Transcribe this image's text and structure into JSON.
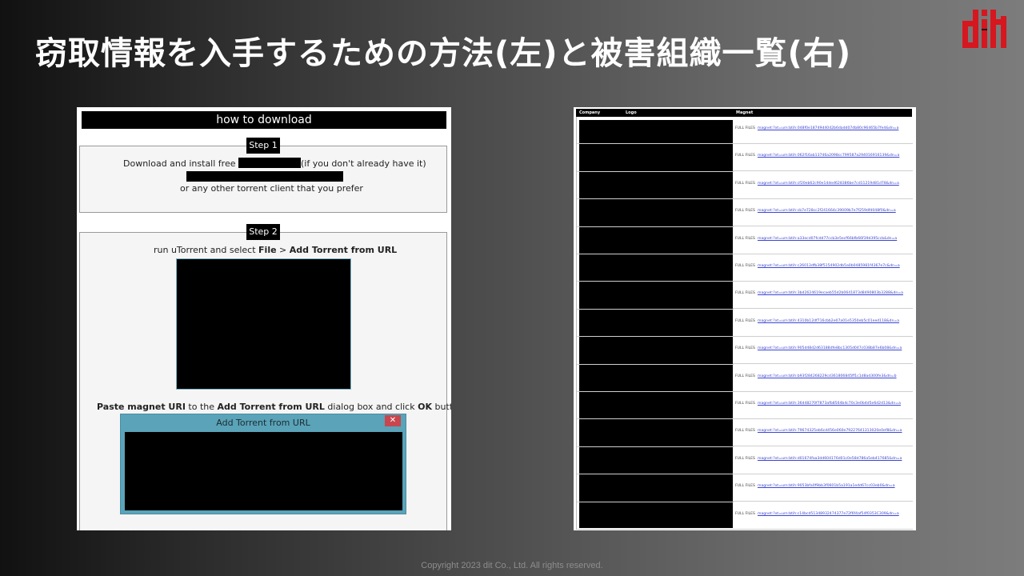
{
  "slide": {
    "title": "窃取情報を入手するための方法(左)と被害組織一覧(右)",
    "logo_text": "dit",
    "footer": "Copyright 2023 dit Co., Ltd. All rights reserved."
  },
  "left_panel": {
    "heading": "how to download",
    "step1": {
      "label": "Step 1",
      "line1_prefix": "Download and install free",
      "line1_suffix": "(if you don't already have it)",
      "line3": "or any other torrent client that you prefer"
    },
    "step2": {
      "label": "Step 2",
      "instr_prefix": "run uTorrent and select ",
      "instr_file": "File",
      "instr_sep": " > ",
      "instr_menu": "Add Torrent from URL",
      "paste_part1": "Paste magnet URI",
      "paste_part2": " to the ",
      "paste_part3": "Add Torrent from URL",
      "paste_part4": " dialog box and click ",
      "paste_part5": "OK",
      "paste_part6": " button.",
      "dialog_title": "Add Torrent from URL",
      "dialog_close": "✕"
    }
  },
  "right_panel": {
    "columns": [
      "Company",
      "Logo",
      "Magnet"
    ],
    "rows": [
      {
        "files": "FULL FILES",
        "magnet": "magnet:?xt=urn:btih:048f0e18749d4042b6dadd07db80c96465b7fe4&dn=a"
      },
      {
        "files": "FULL FILES",
        "magnet": "magnet:?xt=urn:btih:062f16ab13746a2098cc799587a294016916139&dn=a"
      },
      {
        "files": "FULL FILES",
        "magnet": "magnet:?xt=urn:btih:cf20eb62c90e14ded628386be7cd11219d81d78&dn=a"
      },
      {
        "files": "FULL FILES",
        "magnet": "magnet:?xt=urn:btih:cb7e728cc2f241664c39009b7e7f259dfd048f0&dn=a"
      },
      {
        "files": "FULL FILES",
        "magnet": "magnet:?xt=urn:btih:a33ecd07fcdd77ccb3e5ecf66bfb66f39d395ccb&dn=a"
      },
      {
        "files": "FULL FILES",
        "magnet": "magnet:?xt=urn:btih:c26013dfb38f5154902db5a0b0485981f4367e7c&dn=a"
      },
      {
        "files": "FULL FILES",
        "magnet": "magnet:?xt=urn:btih:3bd2624619ecaeb55d2b0641873d8490803b3288&dn=a"
      },
      {
        "files": "FULL FILES",
        "magnet": "magnet:?xt=urn:btih:4310b12df716cbb2e07a01e5350eb5c01eed118&dn=a"
      },
      {
        "files": "FULL FILES",
        "magnet": "magnet:?xt=urn:btih:905d48d2d63188dfe8bc1305d047c038b87e6b08&dn=a"
      },
      {
        "files": "FULL FILES",
        "magnet": "magnet:?xt=urn:btih:b93f284268229cd361806845ff1c1d8ad300fe3&dn=b"
      },
      {
        "files": "FULL FILES",
        "magnet": "magnet:?xt=urn:btih:36d48270f7873afb8564b4c70c3e0b4d5e6d2d13&dn=a"
      },
      {
        "files": "FULL FILES",
        "magnet": "magnet:?xt=urn:btih:79674325eb6cd456e060e79227641313020e0ef8&dn=a"
      },
      {
        "files": "FULL FILES",
        "magnet": "magnet:?xt=urn:btih:d01674faa3dd604176d01c0e58d786a5eb417685&dn=a"
      },
      {
        "files": "FULL FILES",
        "magnet": "magnet:?xt=urn:btih:9053bfa0f9bb3f0601b5a191a1edd67cc03eb0&dn=a"
      },
      {
        "files": "FULL FILES",
        "magnet": "magnet:?xt=urn:btih:c14bcd51348932474377e72f6f4af54f0353C309&dn=a"
      }
    ]
  },
  "colors": {
    "logo_red": "#d6171f",
    "dialog_teal": "#5aa3b8",
    "link_blue": "#3c46d0"
  }
}
